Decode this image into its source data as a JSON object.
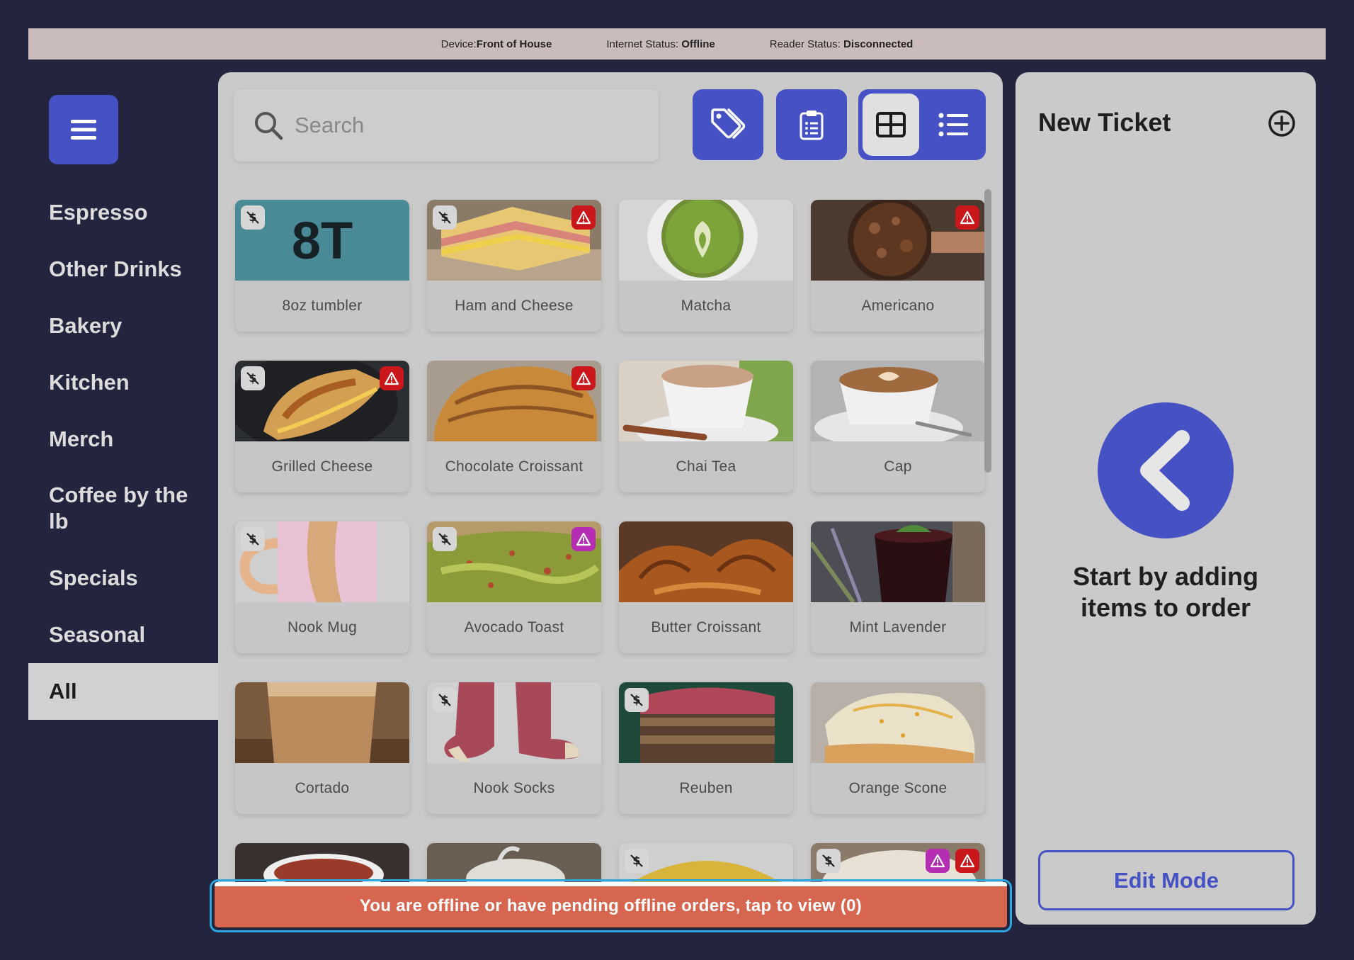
{
  "status_bar": {
    "device_label": "Device:",
    "device_value": "Front of House",
    "internet_label": "Internet Status:",
    "internet_value": "Offline",
    "reader_label": "Reader Status:",
    "reader_value": "Disconnected"
  },
  "sidebar": {
    "menu_icon": "hamburger-icon",
    "categories": [
      {
        "label": "Espresso"
      },
      {
        "label": "Other Drinks"
      },
      {
        "label": "Bakery"
      },
      {
        "label": "Kitchen"
      },
      {
        "label": "Merch"
      },
      {
        "label": "Coffee by the lb"
      },
      {
        "label": "Specials"
      },
      {
        "label": "Seasonal"
      },
      {
        "label": "All",
        "active": true
      }
    ]
  },
  "toolbar": {
    "search_placeholder": "Search",
    "discount_icon": "tags-icon",
    "clipboard_icon": "clipboard-list-icon",
    "grid_view_icon": "grid-view-icon",
    "list_view_icon": "list-view-icon",
    "selected_view": "grid"
  },
  "items": [
    {
      "name": "8oz tumbler",
      "thumb_text": "8T",
      "no_price": true
    },
    {
      "name": "Ham and Cheese",
      "no_price": true,
      "warning": "red"
    },
    {
      "name": "Matcha"
    },
    {
      "name": "Americano",
      "warning": "red"
    },
    {
      "name": "Grilled Cheese",
      "no_price": true,
      "warning": "red"
    },
    {
      "name": "Chocolate Croissant",
      "warning": "red"
    },
    {
      "name": "Chai Tea"
    },
    {
      "name": "Cap"
    },
    {
      "name": "Nook Mug",
      "no_price": true
    },
    {
      "name": "Avocado Toast",
      "no_price": true,
      "warning": "purple"
    },
    {
      "name": "Butter Croissant"
    },
    {
      "name": "Mint Lavender"
    },
    {
      "name": "Cortado"
    },
    {
      "name": "Nook Socks",
      "no_price": true
    },
    {
      "name": "Reuben",
      "no_price": true
    },
    {
      "name": "Orange Scone"
    }
  ],
  "offline_banner": {
    "text": "You are offline or have pending offline orders, tap to view (0)"
  },
  "ticket": {
    "title": "New Ticket",
    "add_icon": "plus-circle-icon",
    "back_icon": "chevron-left-icon",
    "empty_line1": "Start by adding",
    "empty_line2": "items to order",
    "edit_mode_label": "Edit Mode"
  },
  "colors": {
    "accent": "#4651c4",
    "background": "#23243d",
    "panel": "#cacaca",
    "banner": "#d6664f",
    "warning_red": "#c9171b",
    "warning_purple": "#b52db3"
  }
}
